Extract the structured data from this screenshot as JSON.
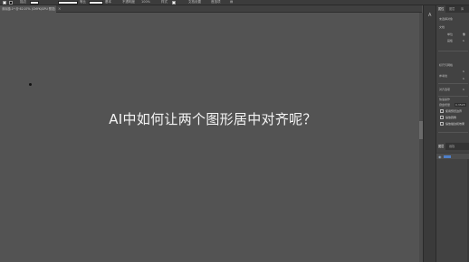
{
  "control_bar": {
    "items": [
      "描边",
      "等比",
      "基本",
      "不透明度",
      "100%",
      "样式",
      "文档设置",
      "首选项"
    ]
  },
  "document": {
    "tab_label": "未标题-1* @ 62.07% (CMYK/GPU 预览)",
    "close_glyph": "×"
  },
  "canvas": {
    "title": "AI中如何让两个图形居中对齐呢？"
  },
  "tool_strip": {
    "icon": "type-tool-icon",
    "glyph": "A"
  },
  "properties_panel": {
    "tabs": [
      "属性",
      "图层",
      "库"
    ],
    "section_label": "未选择对象",
    "labels": [
      "文档",
      "单位",
      "画板",
      "标尺与网格",
      "参考线",
      "对齐选项",
      "快速操作"
    ],
    "values": [
      "像",
      "1",
      "1",
      "1",
      "1"
    ],
    "keyboard_increment_label": "键盘增量",
    "keyboard_increment_value": "0.3528",
    "checkboxes": [
      {
        "label": "使用预览边界",
        "checked": false
      },
      {
        "label": "缩放圆角",
        "checked": false
      },
      {
        "label": "缩放描边和效果",
        "checked": false
      }
    ]
  },
  "layers_panel": {
    "tabs": [
      "图层",
      "画板"
    ],
    "row_icon": "eye-icon"
  },
  "colors": {
    "canvas": "#535353",
    "panel": "#424242",
    "toolbar": "#3c3c3c",
    "layer_accent": "#4f7fc8"
  }
}
